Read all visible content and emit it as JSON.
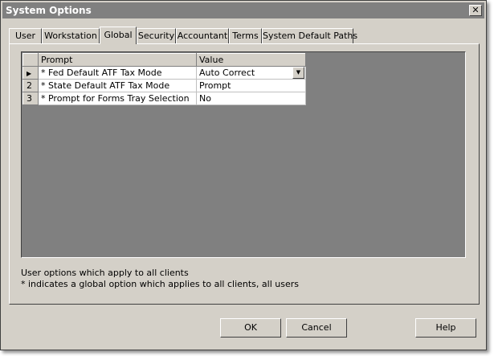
{
  "window": {
    "title": "System Options",
    "close_glyph": "✕"
  },
  "tabs": [
    {
      "label": "User",
      "active": false
    },
    {
      "label": "Workstation",
      "active": false
    },
    {
      "label": "Global",
      "active": true
    },
    {
      "label": "Security",
      "active": false
    },
    {
      "label": "Accountant",
      "active": false
    },
    {
      "label": "Terms",
      "active": false
    },
    {
      "label": "System Default Paths",
      "active": false
    }
  ],
  "grid": {
    "columns": [
      "Prompt",
      "Value"
    ],
    "rows": [
      {
        "row_label": "▶",
        "prompt": "* Fed Default ATF Tax Mode",
        "value": "Auto Correct"
      },
      {
        "row_label": "2",
        "prompt": "* State Default ATF Tax Mode",
        "value": "Prompt"
      },
      {
        "row_label": "3",
        "prompt": "* Prompt for Forms Tray Selection",
        "value": "No"
      }
    ],
    "dropdown_glyph": "▼"
  },
  "notes": {
    "line1": "User options which apply to all clients",
    "line2": "* indicates a global option which applies to all clients, all users"
  },
  "buttons": {
    "ok": "OK",
    "cancel": "Cancel",
    "help": "Help"
  }
}
